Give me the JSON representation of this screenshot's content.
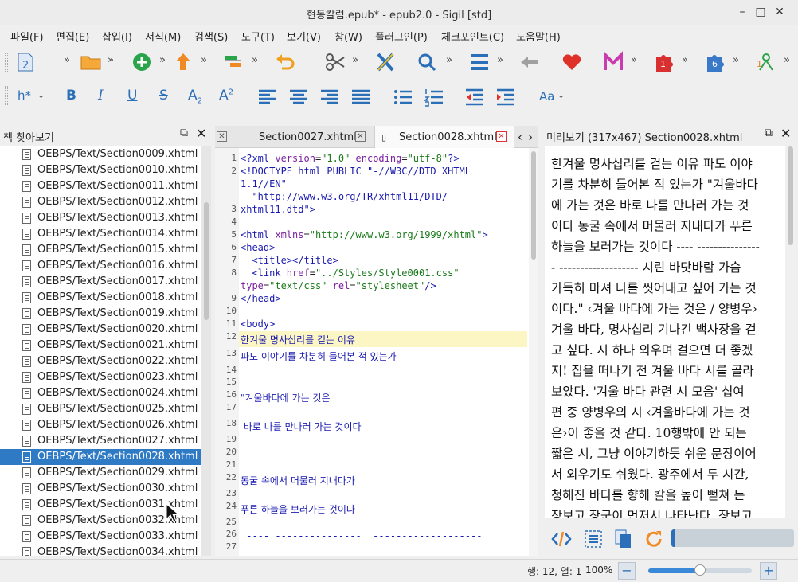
{
  "window": {
    "title": "현동칼럼.epub* - epub2.0 - Sigil [std]",
    "minimize": "–",
    "maximize": "□",
    "close": "✕"
  },
  "menu": [
    "파일(F)",
    "편집(E)",
    "삽입(I)",
    "서식(M)",
    "검색(S)",
    "도구(T)",
    "보기(V)",
    "창(W)",
    "플러그인(P)",
    "체크포인트(C)",
    "도움말(H)"
  ],
  "toolbar": {
    "more": "»",
    "heading_label": "h*",
    "bold": "B",
    "italic": "I",
    "underline": "U",
    "strike": "S",
    "subscript": "A",
    "subscript_mark": "2",
    "superscript": "A",
    "superscript_mark": "2",
    "case_label": "Aa",
    "badge_1": "1",
    "badge_6": "6"
  },
  "book_browser": {
    "title": "책 찾아보기",
    "files": [
      "OEBPS/Text/Section0009.xhtml",
      "OEBPS/Text/Section0010.xhtml",
      "OEBPS/Text/Section0011.xhtml",
      "OEBPS/Text/Section0012.xhtml",
      "OEBPS/Text/Section0013.xhtml",
      "OEBPS/Text/Section0014.xhtml",
      "OEBPS/Text/Section0015.xhtml",
      "OEBPS/Text/Section0016.xhtml",
      "OEBPS/Text/Section0017.xhtml",
      "OEBPS/Text/Section0018.xhtml",
      "OEBPS/Text/Section0019.xhtml",
      "OEBPS/Text/Section0020.xhtml",
      "OEBPS/Text/Section0021.xhtml",
      "OEBPS/Text/Section0022.xhtml",
      "OEBPS/Text/Section0023.xhtml",
      "OEBPS/Text/Section0024.xhtml",
      "OEBPS/Text/Section0025.xhtml",
      "OEBPS/Text/Section0026.xhtml",
      "OEBPS/Text/Section0027.xhtml",
      "OEBPS/Text/Section0028.xhtml",
      "OEBPS/Text/Section0029.xhtml",
      "OEBPS/Text/Section0030.xhtml",
      "OEBPS/Text/Section0031.xhtml",
      "OEBPS/Text/Section0032.xhtml",
      "OEBPS/Text/Section0033.xhtml",
      "OEBPS/Text/Section0034.xhtml"
    ],
    "selected_file": "OEBPS/Text/Section0028.xhtml"
  },
  "editor": {
    "tabs": [
      {
        "label": "Section0027.xhtml",
        "active": false
      },
      {
        "label": "Section0028.xhtml",
        "active": true
      }
    ],
    "tab_close": "✕",
    "tab_nav_left": "‹",
    "tab_nav_right": "›",
    "line_numbers": [
      "1",
      "2",
      "",
      "",
      "3",
      "4",
      "5",
      "6",
      "7",
      "8",
      "",
      "9",
      "10",
      "11",
      "12",
      "13",
      "14",
      "15",
      "16",
      "17",
      "18",
      "19",
      "20",
      "21",
      "22",
      "23",
      "24",
      "25",
      "26",
      "27"
    ],
    "code": {
      "l1a": "<?xml ",
      "l1b": "version",
      "l1c": "=",
      "l1d": "\"1.0\"",
      "l1e": " encoding",
      "l1f": "=",
      "l1g": "\"utf-8\"",
      "l1h": "?>",
      "l2a": "<!DOCTYPE html PUBLIC \"-//W3C//DTD XHTML",
      "l2b": "1.1//EN\"",
      "l3a": "  \"http://www.w3.org/TR/xhtml11/DTD/",
      "l3b": "xhtml11.dtd\">",
      "l5a": "<html ",
      "l5b": "xmlns",
      "l5c": "=",
      "l5d": "\"http://www.w3.org/1999/xhtml\"",
      "l5e": ">",
      "l6": "<head>",
      "l7": "  <title></title>",
      "l8a": "  <link ",
      "l8b": "href",
      "l8c": "=",
      "l8d": "\"../Styles/Style0001.css\"",
      "l8e": "type",
      "l8f": "=",
      "l8g": "\"text/css\"",
      "l8h": " rel",
      "l8i": "=",
      "l8j": "\"stylesheet\"",
      "l8k": "/>",
      "l9": "</head>",
      "l11": "<body>",
      "l12": "한겨울 명사십리를 걷는 이유",
      "l13": "파도 이야기를 차분히 들어본 적 있는가",
      "l16": "\"겨울바다에 가는 것은",
      "l18": " 바로 나를 만나러 가는 것이다",
      "l22": "동굴 속에서 머물러 지내다가",
      "l24": "푸른 하늘을 보러가는 것이다",
      "l26": " ---- ---------------  -------------------"
    }
  },
  "preview": {
    "title": "미리보기 (317x467) Section0028.xhtml",
    "lines": [
      "한겨울 명사십리를 걷는 이유 파도 이야",
      "기를 차분히 들어본 적 있는가 \"겨울바다",
      "에 가는 것은 바로 나를 만나러 가는 것",
      "이다 동굴 속에서 머물러 지내다가 푸른",
      "하늘을 보러가는 것이다 ---- ---------------",
      "- ------------------- 시린 바닷바람 가슴",
      "가득히 마셔 나를 씻어내고 싶어 가는 것",
      "이다.\" ‹겨울 바다에 가는 것은 / 양병우›",
      "겨울 바다, 명사십리 기나긴 백사장을 걷",
      "고 싶다. 시 하나 외우며 걸으면 더 좋겠",
      "지! 집을 떠나기 전 겨울 바다 시를 골라",
      "보았다. '겨울 바다 관련 시 모음' 십여",
      "편 중 양병우의 시 ‹겨울바다에 가는 것",
      "은›이 좋을 것 같다. 10행밖에 안 되는",
      "짧은 시, 그냥 이야기하듯 쉬운 문장이어",
      "서 외우기도 쉬웠다. 광주에서 두 시간,",
      "청해진 바다를 향해 칼을 높이 뻗쳐 든",
      "장보고 장군이 먼저서 나타난다. 장보고"
    ]
  },
  "status": {
    "position": "행: 12, 열: 1",
    "zoom": "100%",
    "zoom_out": "−",
    "zoom_in": "+",
    "zoom_level": 0.5
  },
  "colors": {
    "selection": "#2f7ac4",
    "current_line": "#fbf6c4",
    "accent_red": "#e0302a",
    "accent_blue": "#2b6fb8"
  }
}
